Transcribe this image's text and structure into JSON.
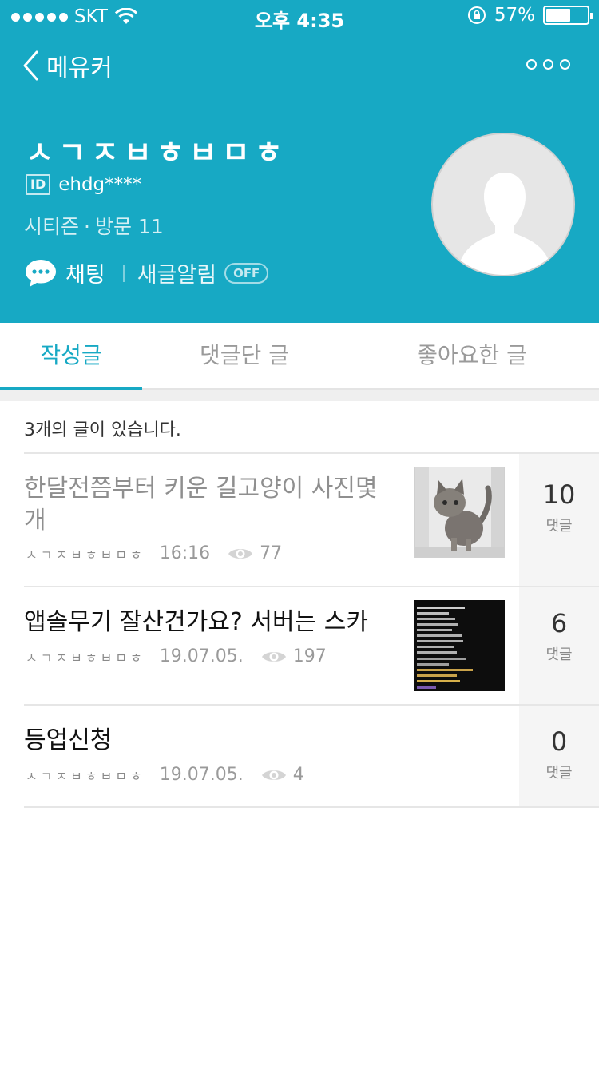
{
  "colors": {
    "accent": "#17a9c4",
    "comment_bg": "#f5f5f5",
    "read_title": "#8f8f8f"
  },
  "status_bar": {
    "carrier": "SKT",
    "time": "오후 4:35",
    "battery": "57%"
  },
  "nav": {
    "back_label": "메유커",
    "back_icon": "chevron-left-icon",
    "more_icon": "more-dots-icon"
  },
  "profile": {
    "nickname": "ㅅㄱㅈㅂㅎㅂㅁㅎ",
    "id_badge": "ID",
    "user_id": "ehdg****",
    "grade": "시티즌",
    "visit_sep": "·",
    "visits": "방문 11",
    "chat_label": "채팅",
    "notify_label": "새글알림",
    "notify_toggle": "OFF"
  },
  "tabs": [
    {
      "label": "작성글",
      "active": true
    },
    {
      "label": "댓글단 글",
      "active": false
    },
    {
      "label": "좋아요한 글",
      "active": false
    }
  ],
  "list": {
    "count_text": "3개의 글이 있습니다.",
    "posts": [
      {
        "title": "한달전쯤부터 키운 길고양이 사진몇개",
        "author": "ㅅㄱㅈㅂㅎㅂㅁㅎ",
        "date": "16:16",
        "views": "77",
        "comments": "10",
        "comment_label": "댓글",
        "read": true,
        "thumbnail": "cat-photo"
      },
      {
        "title": "앱솔무기 잘산건가요? 서버는 스카",
        "author": "ㅅㄱㅈㅂㅎㅂㅁㅎ",
        "date": "19.07.05.",
        "views": "197",
        "comments": "6",
        "comment_label": "댓글",
        "read": false,
        "thumbnail": "game-stats-screenshot"
      },
      {
        "title": "등업신청",
        "author": "ㅅㄱㅈㅂㅎㅂㅁㅎ",
        "date": "19.07.05.",
        "views": "4",
        "comments": "0",
        "comment_label": "댓글",
        "read": false,
        "thumbnail": ""
      }
    ]
  }
}
